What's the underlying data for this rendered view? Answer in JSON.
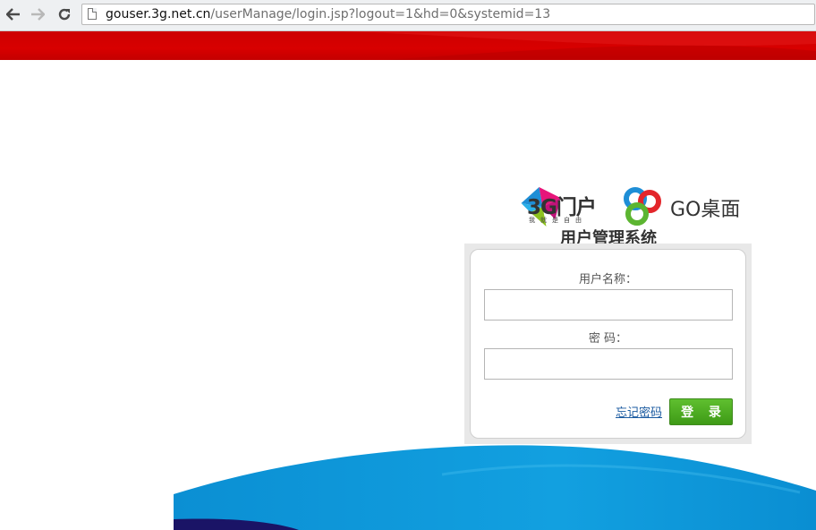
{
  "browser": {
    "url_host": "gouser.3g.net.cn",
    "url_path": "/userManage/login.jsp?logout=1&hd=0&systemid=13",
    "icons": [
      "back-arrow-icon",
      "forward-arrow-icon",
      "reload-icon",
      "page-icon"
    ]
  },
  "logos": {
    "portal_name": "3G门户",
    "portal_slogan": "我就是自由",
    "launcher_name": "GO桌面"
  },
  "system_title": "用户管理系统",
  "login": {
    "username_label": "用户名称：",
    "username_value": "",
    "password_label": "密 码：",
    "password_value": "",
    "forgot_link": "忘记密码",
    "submit_label": "登 录"
  },
  "colors": {
    "banner_red": "#d10000",
    "login_button_green": "#4aa81f",
    "wave_blue": "#0d93d6",
    "wave_navy": "#1a1466"
  }
}
